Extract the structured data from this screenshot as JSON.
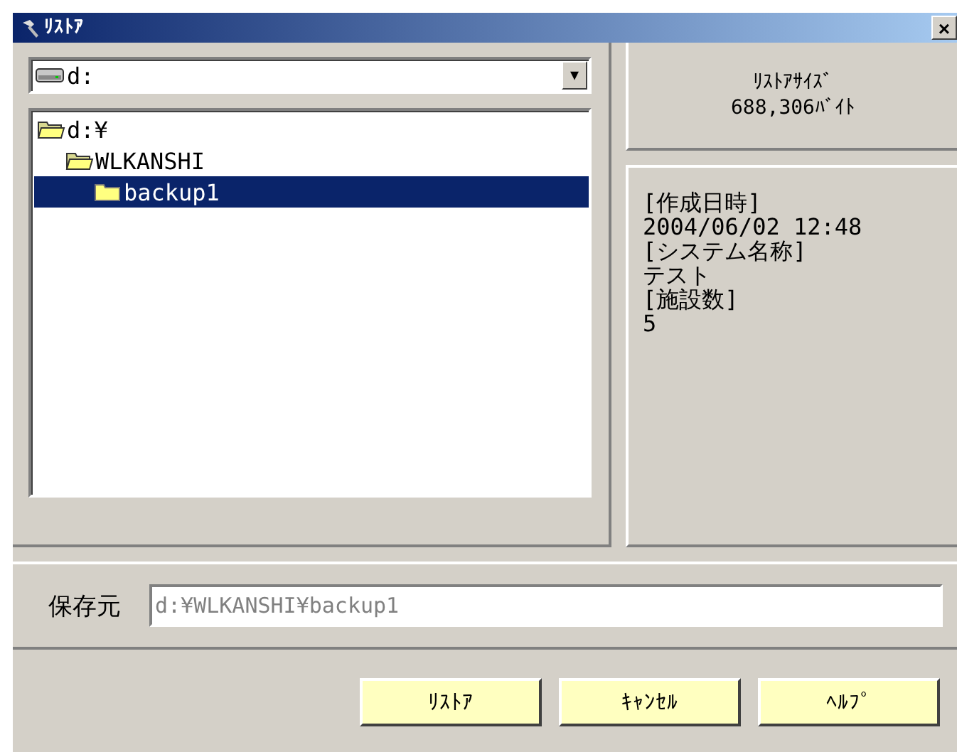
{
  "window": {
    "title": "ﾘｽﾄｱ",
    "close": "×"
  },
  "drive_select": {
    "value": "d:",
    "arrow": "▼"
  },
  "folder_tree": [
    {
      "label": "d:¥",
      "expanded": true,
      "selected": false,
      "children": [
        {
          "label": "WLKANSHI",
          "expanded": true,
          "selected": false,
          "children": [
            {
              "label": "backup1",
              "expanded": false,
              "selected": true
            }
          ]
        }
      ]
    }
  ],
  "restore_size": {
    "label": "ﾘｽﾄｱｻｲｽﾞ",
    "value": "688,306ﾊﾞｲﾄ"
  },
  "info_lines": [
    "[作成日時]",
    "2004/06/02 12:48",
    "[システム名称]",
    "テスト",
    "[施設数]",
    "5"
  ],
  "source": {
    "label": "保存元",
    "value": "d:¥WLKANSHI¥backup1",
    "disabled": true
  },
  "buttons": [
    "ﾘｽﾄｱ",
    "ｷｬﾝｾﾙ",
    "ﾍﾙﾌﾟ"
  ]
}
